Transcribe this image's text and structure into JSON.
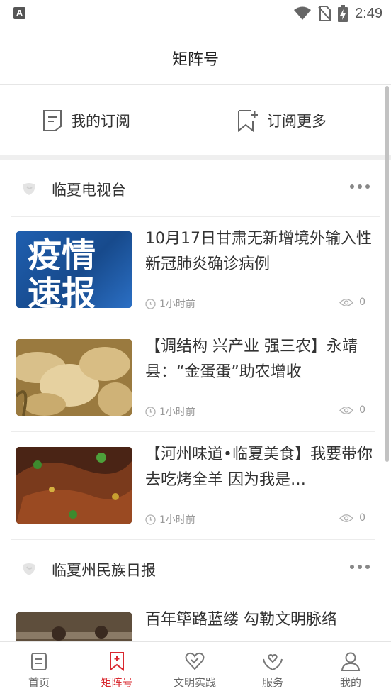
{
  "status_bar": {
    "time": "2:49",
    "left_icon_letter": "A",
    "icons": [
      "notification-a-icon",
      "wifi-icon",
      "no-sim-icon",
      "battery-charging-icon"
    ]
  },
  "header": {
    "title": "矩阵号"
  },
  "subscriptions": {
    "my_label": "我的订阅",
    "more_label": "订阅更多"
  },
  "sections": [
    {
      "source": "临夏电视台",
      "articles": [
        {
          "title": "10月17日甘肃无新增境外输入性新冠肺炎确诊病例",
          "time": "1小时前",
          "views": "0",
          "thumb_text": [
            "疫情",
            "速报"
          ]
        },
        {
          "title": "【调结构 兴产业 强三农】永靖县：“金蛋蛋”助农增收",
          "time": "1小时前",
          "views": "0"
        },
        {
          "title": "【河州味道•临夏美食】我要带你去吃烤全羊 因为我是…",
          "time": "1小时前",
          "views": "0"
        }
      ]
    },
    {
      "source": "临夏州民族日报",
      "articles": [
        {
          "title": "百年筚路蓝缕 勾勒文明脉络",
          "time": "",
          "views": ""
        }
      ]
    }
  ],
  "tabs": [
    {
      "label": "首页",
      "icon": "home-icon",
      "active": false
    },
    {
      "label": "矩阵号",
      "icon": "bookmark-icon",
      "active": true
    },
    {
      "label": "文明实践",
      "icon": "heart-icon",
      "active": false
    },
    {
      "label": "服务",
      "icon": "hands-heart-icon",
      "active": false
    },
    {
      "label": "我的",
      "icon": "user-icon",
      "active": false
    }
  ],
  "colors": {
    "accent": "#d9282f",
    "text": "#333333",
    "muted": "#9a9a9a"
  }
}
